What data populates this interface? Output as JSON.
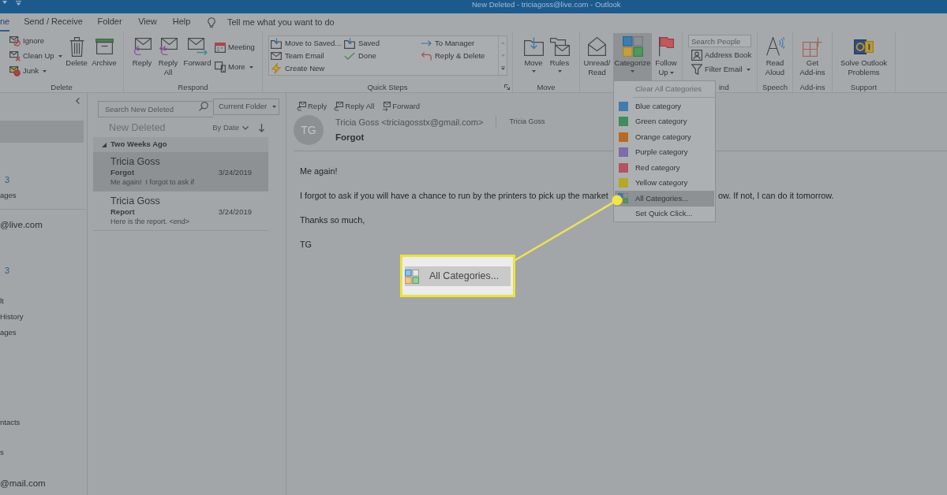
{
  "window": {
    "title": "New Deleted - triciagoss@live.com - Outlook"
  },
  "ribbon_tabs": [
    {
      "label": "ne",
      "selected": true
    },
    {
      "label": "Send / Receive",
      "selected": false
    },
    {
      "label": "Folder",
      "selected": false
    },
    {
      "label": "View",
      "selected": false
    },
    {
      "label": "Help",
      "selected": false
    }
  ],
  "tell_me": {
    "placeholder": "Tell me what you want to do"
  },
  "ribbon": {
    "delete": {
      "label": "Delete",
      "small": [
        {
          "label": "Ignore",
          "dropdown": false
        },
        {
          "label": "Clean Up",
          "dropdown": true
        },
        {
          "label": "Junk",
          "dropdown": true
        }
      ],
      "large": [
        {
          "label": "Delete",
          "dropdown": false
        },
        {
          "label": "Archive",
          "dropdown": false
        }
      ]
    },
    "respond": {
      "label": "Respond",
      "large": [
        {
          "label": "Reply",
          "dropdown": false
        },
        {
          "label": "Reply\nAll",
          "dropdown": false
        },
        {
          "label": "Forward",
          "dropdown": false
        }
      ],
      "small": [
        {
          "label": "Meeting",
          "dropdown": false
        },
        {
          "label": "More",
          "dropdown": true
        }
      ]
    },
    "quick_steps": {
      "label": "Quick Steps",
      "columns": [
        [
          "Move to Saved...",
          "Team Email",
          "Create New"
        ],
        [
          "Saved",
          "Done"
        ],
        [
          "To Manager",
          "Reply & Delete"
        ]
      ]
    },
    "move": {
      "label": "Move",
      "large": [
        {
          "label": "Move",
          "dropdown": true
        },
        {
          "label": "Rules",
          "dropdown": true
        }
      ]
    },
    "tags": {
      "large": [
        {
          "label": "Unread/\nRead",
          "dropdown": false,
          "expanded": false
        },
        {
          "label": "Categorize",
          "dropdown": true,
          "expanded": true
        },
        {
          "label": "Follow\nUp",
          "dropdown": true,
          "expanded": false
        }
      ]
    },
    "find": {
      "label": "ind",
      "search": {
        "placeholder": "Search People"
      },
      "small": [
        {
          "label": "Address Book",
          "dropdown": false
        },
        {
          "label": "Filter Email",
          "dropdown": true
        }
      ]
    },
    "speech": {
      "label": "Speech",
      "large": [
        {
          "label": "Read\nAloud",
          "dropdown": false
        }
      ]
    },
    "add_ins": {
      "label": "Add-ins",
      "large": [
        {
          "label": "Get\nAdd-ins",
          "dropdown": false
        }
      ]
    },
    "support": {
      "label": "Support",
      "large": [
        {
          "label": "Solve Outlook\nProblems",
          "dropdown": false
        }
      ]
    }
  },
  "folder_pane": {
    "sections": [
      {
        "items": [
          {
            "kind": "name",
            "selected": true
          },
          {
            "kind": "count",
            "label": "3",
            "selected": false
          },
          {
            "kind": "name",
            "label": "ages",
            "selected": false
          }
        ]
      },
      {
        "account": "@live.com",
        "items": [
          {
            "kind": "count",
            "label": "3",
            "selected": false
          },
          {
            "kind": "name",
            "label": "lt",
            "selected": false
          },
          {
            "kind": "name",
            "label": "History",
            "selected": false
          },
          {
            "kind": "name",
            "label": "ages",
            "selected": false
          },
          {
            "kind": "name",
            "label": "ntacts",
            "selected": false
          },
          {
            "kind": "name",
            "label": "s",
            "selected": false
          }
        ]
      },
      {
        "account": "@mail.com"
      }
    ]
  },
  "message_list": {
    "search": {
      "placeholder": "Search New Deleted"
    },
    "scope": "Current Folder",
    "folder": "New Deleted",
    "sort": "By Date",
    "groups": [
      {
        "label": "Two Weeks Ago",
        "expanded": true,
        "messages": [
          {
            "sender": "Tricia Goss",
            "subject": "Forgot",
            "preview": "Me again!  I forgot to ask if",
            "date": "3/24/2019",
            "selected": true
          },
          {
            "sender": "Tricia Goss",
            "subject": "Report",
            "preview": "Here is the report. <end>",
            "date": "3/24/2019",
            "selected": false
          }
        ]
      }
    ]
  },
  "reading_pane": {
    "actions": [
      "Reply",
      "Reply All",
      "Forward"
    ],
    "avatar": "TG",
    "from": "Tricia Goss <triciagosstx@gmail.com>",
    "to": "Tricia Goss",
    "subject": "Forgot",
    "body": [
      [
        "Me again!"
      ],
      [
        "I forgot to ask if you will have a chance to run by the printers to pick up the market",
        "ow. If not, I can do it tomorrow."
      ],
      [
        "Thanks so much,"
      ],
      [
        "TG"
      ]
    ]
  },
  "categorize_menu": {
    "items": [
      {
        "kind": "command",
        "label": "Clear All Categories",
        "disabled": true,
        "selected": false
      },
      {
        "kind": "category",
        "label": "Blue category",
        "color": "#3f7cb0",
        "disabled": false,
        "selected": false
      },
      {
        "kind": "category",
        "label": "Green category",
        "color": "#3f8c5c",
        "disabled": false,
        "selected": false
      },
      {
        "kind": "category",
        "label": "Orange category",
        "color": "#b86a22",
        "disabled": false,
        "selected": false
      },
      {
        "kind": "category",
        "label": "Purple category",
        "color": "#7c6cac",
        "disabled": false,
        "selected": false
      },
      {
        "kind": "category",
        "label": "Red category",
        "color": "#b4545e",
        "disabled": false,
        "selected": false
      },
      {
        "kind": "category",
        "label": "Yellow category",
        "color": "#b5a728",
        "disabled": false,
        "selected": false
      },
      {
        "kind": "manager",
        "label": "All Categories...",
        "disabled": false,
        "selected": true
      },
      {
        "kind": "command",
        "label": "Set Quick Click...",
        "disabled": false,
        "selected": false
      }
    ]
  },
  "callout": {
    "label": "All Categories..."
  }
}
